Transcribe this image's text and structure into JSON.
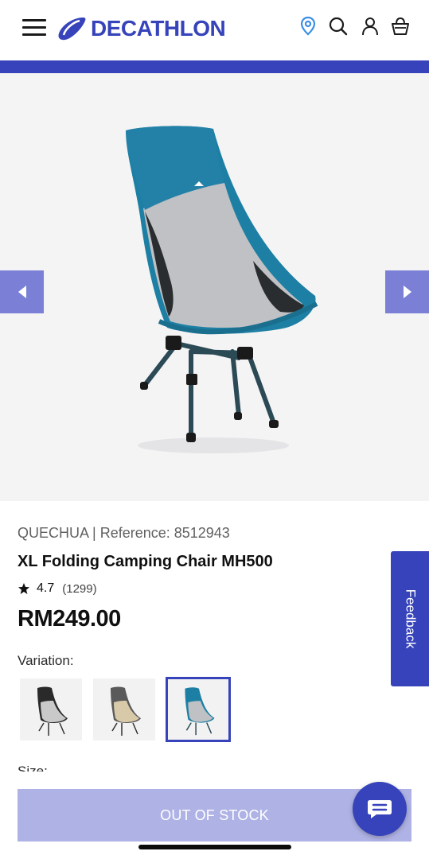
{
  "header": {
    "logo_text": "DECATHLON",
    "icons": [
      "menu-icon",
      "location-pin-icon",
      "search-icon",
      "account-icon",
      "basket-icon"
    ],
    "brand_color": "#3643ba"
  },
  "product": {
    "brand_reference": "QUECHUA | Reference: 8512943",
    "title": "XL Folding Camping Chair MH500",
    "rating": "4.7",
    "review_count": "(1299)",
    "price": "RM249.00",
    "variation_label": "Variation:",
    "variations": [
      "grey-black",
      "beige-grey",
      "blue-grey"
    ],
    "selected_variation_index": 2,
    "size_label": "Size:"
  },
  "feedback": {
    "label": "Feedback"
  },
  "actions": {
    "out_of_stock_label": "OUT OF STOCK"
  }
}
